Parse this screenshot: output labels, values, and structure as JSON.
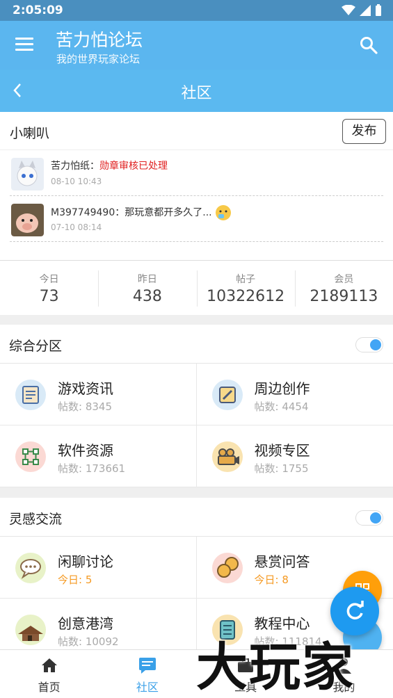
{
  "status": {
    "time": "2:05:09"
  },
  "appbar": {
    "title": "苦力怕论坛",
    "subtitle": "我的世界玩家论坛"
  },
  "subbar": {
    "title": "社区"
  },
  "speaker": {
    "label": "小喇叭",
    "publish": "发布",
    "messages": [
      {
        "user": "苦力怕纸",
        "sep": "：",
        "text": "勋章审核已处理",
        "date": "08-10 10:43",
        "highlight": true
      },
      {
        "user": "M397749490",
        "sep": "：",
        "text": "那玩意都开多久了...",
        "date": "07-10 08:14",
        "highlight": false
      }
    ]
  },
  "stats": [
    {
      "label": "今日",
      "value": "73"
    },
    {
      "label": "昨日",
      "value": "438"
    },
    {
      "label": "帖子",
      "value": "10322612"
    },
    {
      "label": "会员",
      "value": "2189113"
    }
  ],
  "sections": [
    {
      "title": "综合分区",
      "items": [
        {
          "name": "游戏资讯",
          "count": "帖数: 8345",
          "icon": "news-icon"
        },
        {
          "name": "周边创作",
          "count": "帖数: 4454",
          "icon": "edit-icon"
        },
        {
          "name": "软件资源",
          "count": "帖数: 173661",
          "icon": "network-icon"
        },
        {
          "name": "视频专区",
          "count": "帖数: 1755",
          "icon": "camera-icon"
        }
      ]
    },
    {
      "title": "灵感交流",
      "items": [
        {
          "name": "闲聊讨论",
          "count": "今日: 5",
          "icon": "chat-icon",
          "today": true
        },
        {
          "name": "悬赏问答",
          "count": "今日: 8",
          "icon": "coins-icon",
          "today": true
        },
        {
          "name": "创意港湾",
          "count": "帖数: 10092",
          "icon": "house-icon"
        },
        {
          "name": "教程中心",
          "count": "帖数: 111814",
          "icon": "list-icon"
        }
      ]
    }
  ],
  "nav": [
    {
      "label": "首页",
      "icon": "home-icon"
    },
    {
      "label": "社区",
      "icon": "forum-icon",
      "active": true
    },
    {
      "label": "工具",
      "icon": "toolbox-icon"
    },
    {
      "label": "我的",
      "icon": "person-icon"
    }
  ],
  "watermark": "大玩家",
  "colors": {
    "appbar": "#5bb6ef",
    "accent": "#1e9af0",
    "orange": "#ff9f0a",
    "highlight": "#e02020"
  }
}
